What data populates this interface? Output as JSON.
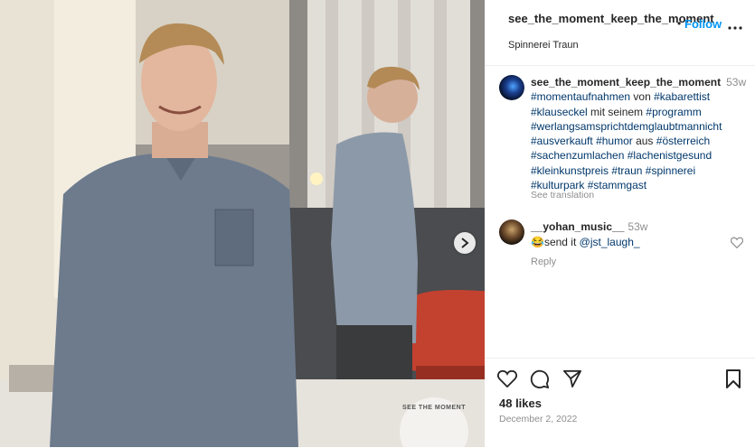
{
  "post": {
    "username": "see_the_moment_keep_the_moment",
    "location": "Spinnerei Traun",
    "follow_label": "Follow",
    "dot": "•",
    "more_label": "•••"
  },
  "caption": {
    "username": "see_the_moment_keep_the_moment",
    "time": "53w",
    "parts": [
      {
        "t": "#momentaufnahmen",
        "tag": true
      },
      {
        "t": " von ",
        "tag": false
      },
      {
        "t": "#kabarettist",
        "tag": true
      },
      {
        "t": " ",
        "tag": false
      },
      {
        "t": "#klauseckel",
        "tag": true
      },
      {
        "t": " mit seinem ",
        "tag": false
      },
      {
        "t": "#programm",
        "tag": true
      },
      {
        "t": " ",
        "tag": false
      },
      {
        "t": "#werlangsamsprichtdemglaubtmannicht",
        "tag": true
      },
      {
        "t": " ",
        "tag": false
      },
      {
        "t": "#ausverkauft",
        "tag": true
      },
      {
        "t": " ",
        "tag": false
      },
      {
        "t": "#humor",
        "tag": true
      },
      {
        "t": " aus ",
        "tag": false
      },
      {
        "t": "#österreich",
        "tag": true
      },
      {
        "t": " ",
        "tag": false
      },
      {
        "t": "#sachenzumlachen",
        "tag": true
      },
      {
        "t": " ",
        "tag": false
      },
      {
        "t": "#lachenistgesund",
        "tag": true
      },
      {
        "t": " ",
        "tag": false
      },
      {
        "t": "#kleinkunstpreis",
        "tag": true
      },
      {
        "t": " ",
        "tag": false
      },
      {
        "t": "#traun",
        "tag": true
      },
      {
        "t": " ",
        "tag": false
      },
      {
        "t": "#spinnerei",
        "tag": true
      },
      {
        "t": " ",
        "tag": false
      },
      {
        "t": "#kulturpark",
        "tag": true
      },
      {
        "t": " ",
        "tag": false
      },
      {
        "t": "#stammgast",
        "tag": true
      }
    ],
    "see_translation": "See translation"
  },
  "comment": {
    "username": "__yohan_music__",
    "time": "53w",
    "emoji": "😂",
    "text": "send it ",
    "mention": "@jst_laugh_",
    "reply_label": "Reply"
  },
  "footer": {
    "likes": "48 likes",
    "date": "December 2, 2022"
  },
  "media": {
    "watermark": "SEE THE MOMENT"
  },
  "icons": {
    "heart": "heart-icon",
    "comment": "comment-icon",
    "share": "share-icon",
    "save": "bookmark-icon",
    "next": "chevron-right-icon"
  },
  "colors": {
    "link": "#0095f6",
    "hashtag": "#00376b",
    "muted": "#8e8e8e"
  }
}
